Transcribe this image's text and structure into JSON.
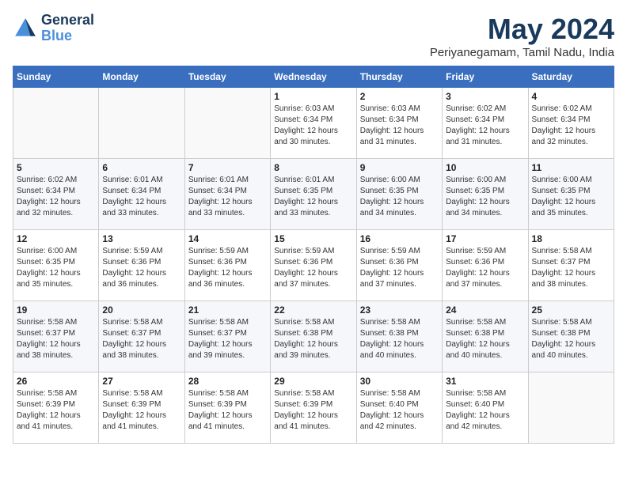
{
  "header": {
    "logo_line1": "General",
    "logo_line2": "Blue",
    "month_year": "May 2024",
    "location": "Periyanegamam, Tamil Nadu, India"
  },
  "weekdays": [
    "Sunday",
    "Monday",
    "Tuesday",
    "Wednesday",
    "Thursday",
    "Friday",
    "Saturday"
  ],
  "weeks": [
    [
      {
        "day": "",
        "info": ""
      },
      {
        "day": "",
        "info": ""
      },
      {
        "day": "",
        "info": ""
      },
      {
        "day": "1",
        "info": "Sunrise: 6:03 AM\nSunset: 6:34 PM\nDaylight: 12 hours\nand 30 minutes."
      },
      {
        "day": "2",
        "info": "Sunrise: 6:03 AM\nSunset: 6:34 PM\nDaylight: 12 hours\nand 31 minutes."
      },
      {
        "day": "3",
        "info": "Sunrise: 6:02 AM\nSunset: 6:34 PM\nDaylight: 12 hours\nand 31 minutes."
      },
      {
        "day": "4",
        "info": "Sunrise: 6:02 AM\nSunset: 6:34 PM\nDaylight: 12 hours\nand 32 minutes."
      }
    ],
    [
      {
        "day": "5",
        "info": "Sunrise: 6:02 AM\nSunset: 6:34 PM\nDaylight: 12 hours\nand 32 minutes."
      },
      {
        "day": "6",
        "info": "Sunrise: 6:01 AM\nSunset: 6:34 PM\nDaylight: 12 hours\nand 33 minutes."
      },
      {
        "day": "7",
        "info": "Sunrise: 6:01 AM\nSunset: 6:34 PM\nDaylight: 12 hours\nand 33 minutes."
      },
      {
        "day": "8",
        "info": "Sunrise: 6:01 AM\nSunset: 6:35 PM\nDaylight: 12 hours\nand 33 minutes."
      },
      {
        "day": "9",
        "info": "Sunrise: 6:00 AM\nSunset: 6:35 PM\nDaylight: 12 hours\nand 34 minutes."
      },
      {
        "day": "10",
        "info": "Sunrise: 6:00 AM\nSunset: 6:35 PM\nDaylight: 12 hours\nand 34 minutes."
      },
      {
        "day": "11",
        "info": "Sunrise: 6:00 AM\nSunset: 6:35 PM\nDaylight: 12 hours\nand 35 minutes."
      }
    ],
    [
      {
        "day": "12",
        "info": "Sunrise: 6:00 AM\nSunset: 6:35 PM\nDaylight: 12 hours\nand 35 minutes."
      },
      {
        "day": "13",
        "info": "Sunrise: 5:59 AM\nSunset: 6:36 PM\nDaylight: 12 hours\nand 36 minutes."
      },
      {
        "day": "14",
        "info": "Sunrise: 5:59 AM\nSunset: 6:36 PM\nDaylight: 12 hours\nand 36 minutes."
      },
      {
        "day": "15",
        "info": "Sunrise: 5:59 AM\nSunset: 6:36 PM\nDaylight: 12 hours\nand 37 minutes."
      },
      {
        "day": "16",
        "info": "Sunrise: 5:59 AM\nSunset: 6:36 PM\nDaylight: 12 hours\nand 37 minutes."
      },
      {
        "day": "17",
        "info": "Sunrise: 5:59 AM\nSunset: 6:36 PM\nDaylight: 12 hours\nand 37 minutes."
      },
      {
        "day": "18",
        "info": "Sunrise: 5:58 AM\nSunset: 6:37 PM\nDaylight: 12 hours\nand 38 minutes."
      }
    ],
    [
      {
        "day": "19",
        "info": "Sunrise: 5:58 AM\nSunset: 6:37 PM\nDaylight: 12 hours\nand 38 minutes."
      },
      {
        "day": "20",
        "info": "Sunrise: 5:58 AM\nSunset: 6:37 PM\nDaylight: 12 hours\nand 38 minutes."
      },
      {
        "day": "21",
        "info": "Sunrise: 5:58 AM\nSunset: 6:37 PM\nDaylight: 12 hours\nand 39 minutes."
      },
      {
        "day": "22",
        "info": "Sunrise: 5:58 AM\nSunset: 6:38 PM\nDaylight: 12 hours\nand 39 minutes."
      },
      {
        "day": "23",
        "info": "Sunrise: 5:58 AM\nSunset: 6:38 PM\nDaylight: 12 hours\nand 40 minutes."
      },
      {
        "day": "24",
        "info": "Sunrise: 5:58 AM\nSunset: 6:38 PM\nDaylight: 12 hours\nand 40 minutes."
      },
      {
        "day": "25",
        "info": "Sunrise: 5:58 AM\nSunset: 6:38 PM\nDaylight: 12 hours\nand 40 minutes."
      }
    ],
    [
      {
        "day": "26",
        "info": "Sunrise: 5:58 AM\nSunset: 6:39 PM\nDaylight: 12 hours\nand 41 minutes."
      },
      {
        "day": "27",
        "info": "Sunrise: 5:58 AM\nSunset: 6:39 PM\nDaylight: 12 hours\nand 41 minutes."
      },
      {
        "day": "28",
        "info": "Sunrise: 5:58 AM\nSunset: 6:39 PM\nDaylight: 12 hours\nand 41 minutes."
      },
      {
        "day": "29",
        "info": "Sunrise: 5:58 AM\nSunset: 6:39 PM\nDaylight: 12 hours\nand 41 minutes."
      },
      {
        "day": "30",
        "info": "Sunrise: 5:58 AM\nSunset: 6:40 PM\nDaylight: 12 hours\nand 42 minutes."
      },
      {
        "day": "31",
        "info": "Sunrise: 5:58 AM\nSunset: 6:40 PM\nDaylight: 12 hours\nand 42 minutes."
      },
      {
        "day": "",
        "info": ""
      }
    ]
  ]
}
